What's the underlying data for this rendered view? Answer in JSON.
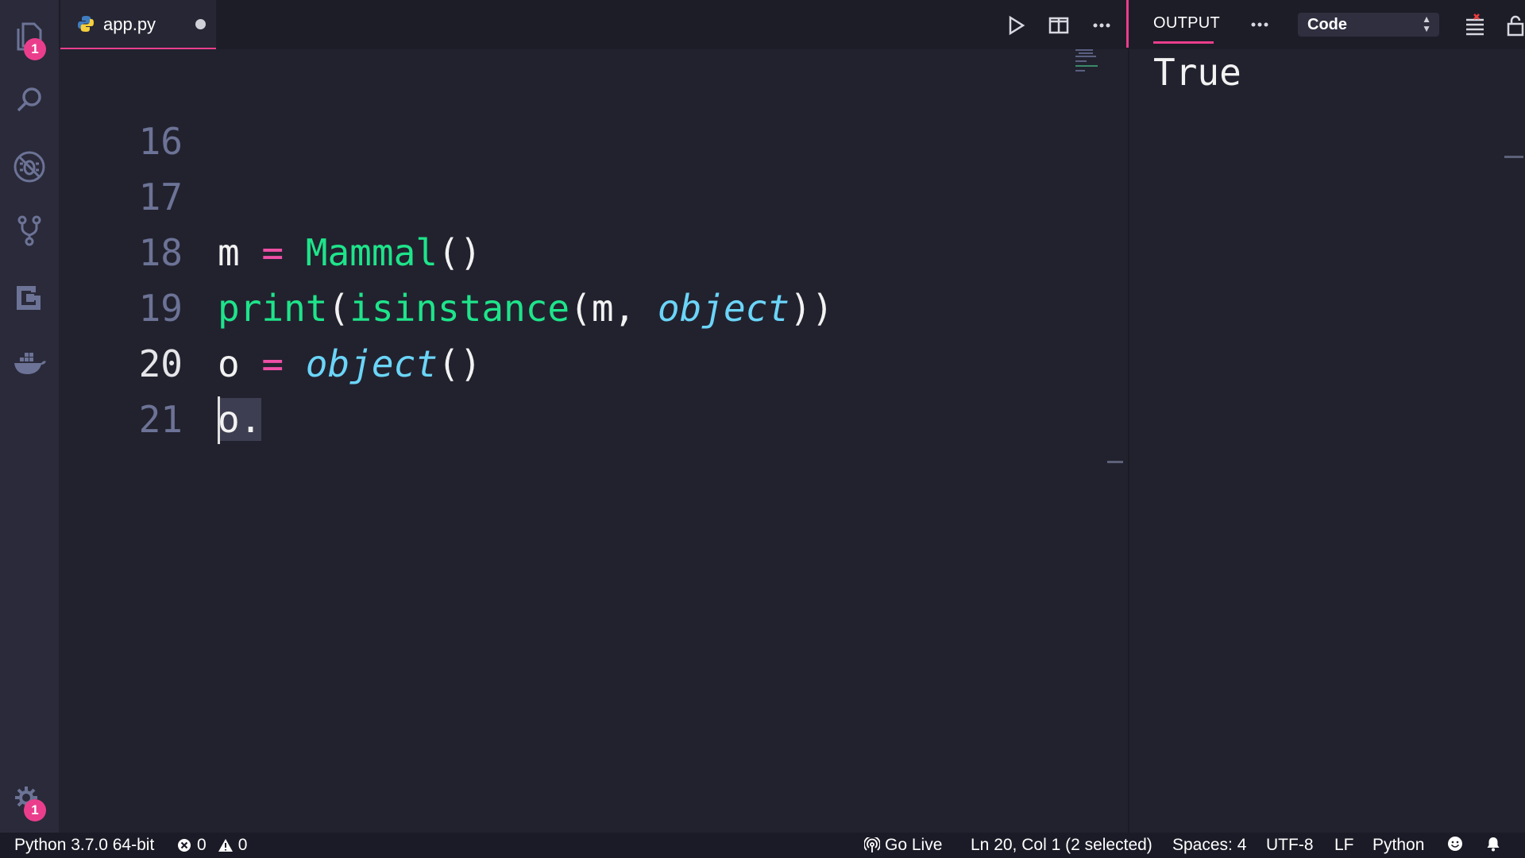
{
  "activity_bar": {
    "explorer_badge": "1",
    "settings_badge": "1"
  },
  "tab": {
    "filename": "app.py"
  },
  "editor": {
    "active_line": 20,
    "lines": [
      {
        "number": "16"
      },
      {
        "number": "17"
      },
      {
        "number": "18"
      },
      {
        "number": "19"
      },
      {
        "number": "20"
      },
      {
        "number": "21"
      }
    ]
  },
  "panel": {
    "tab_label": "OUTPUT",
    "channel_select": "Code",
    "output_text": "True"
  },
  "status_bar": {
    "interpreter": "Python 3.7.0 64-bit",
    "errors": "0",
    "warnings": "0",
    "go_live": "Go Live",
    "cursor_position": "Ln 20, Col 1 (2 selected)",
    "indentation": "Spaces: 4",
    "encoding": "UTF-8",
    "line_ending": "LF",
    "language": "Python"
  },
  "colors": {
    "accent": "#ea3e8c",
    "keyword_green": "#1ee48a",
    "operator_pink": "#ee4fa6",
    "builtin_cyan": "#6bd5f8",
    "background": "#22222f"
  }
}
